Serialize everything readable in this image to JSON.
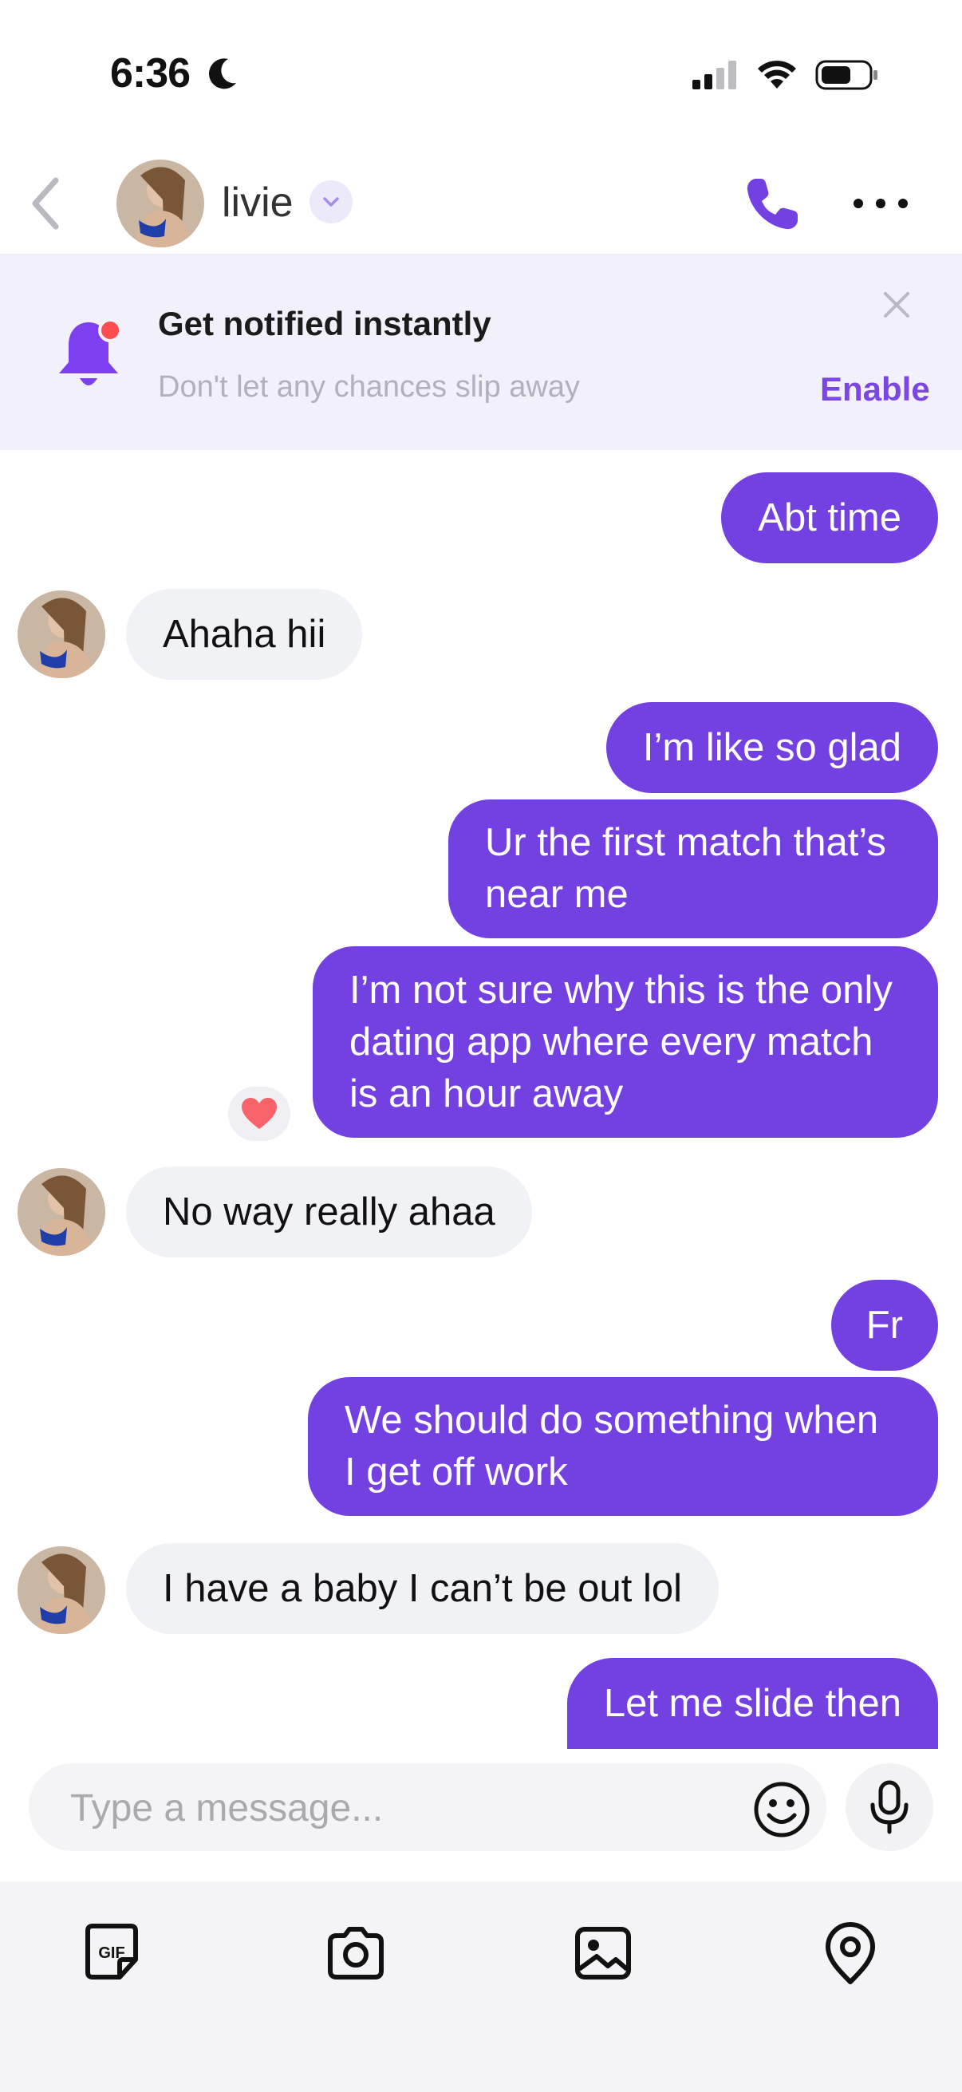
{
  "status_bar": {
    "time": "6:36"
  },
  "header": {
    "name": "livie"
  },
  "banner": {
    "title": "Get notified instantly",
    "subtitle": "Don't let any chances slip away",
    "enable_label": "Enable"
  },
  "messages": [
    {
      "from": "me",
      "lines": [
        "Abt time"
      ]
    },
    {
      "from": "them",
      "lines": [
        "Ahaha hii"
      ]
    },
    {
      "from": "me",
      "lines": [
        "I’m like so glad"
      ]
    },
    {
      "from": "me",
      "lines": [
        "Ur the first match that’s",
        "near me"
      ]
    },
    {
      "from": "me",
      "lines": [
        "I’m not sure why this is the only",
        "dating app where every match",
        "is an hour away"
      ],
      "reaction": "heart"
    },
    {
      "from": "them",
      "lines": [
        "No way really ahaa"
      ]
    },
    {
      "from": "me",
      "lines": [
        "Fr"
      ]
    },
    {
      "from": "me",
      "lines": [
        "We should do something when",
        "I get off work"
      ]
    },
    {
      "from": "them",
      "lines": [
        "I have a baby I can’t be out lol"
      ]
    },
    {
      "from": "me",
      "lines": [
        "Let me slide then"
      ]
    }
  ],
  "composer": {
    "placeholder": "Type a message..."
  },
  "toolbar": {
    "icons": [
      "gif-icon",
      "camera-icon",
      "image-icon",
      "location-icon"
    ]
  },
  "colors": {
    "accent": "#7341e1",
    "incoming_bubble": "#f1f2f6",
    "banner_bg": "#f1f0fb",
    "notification_dot": "#ff4d4f"
  }
}
